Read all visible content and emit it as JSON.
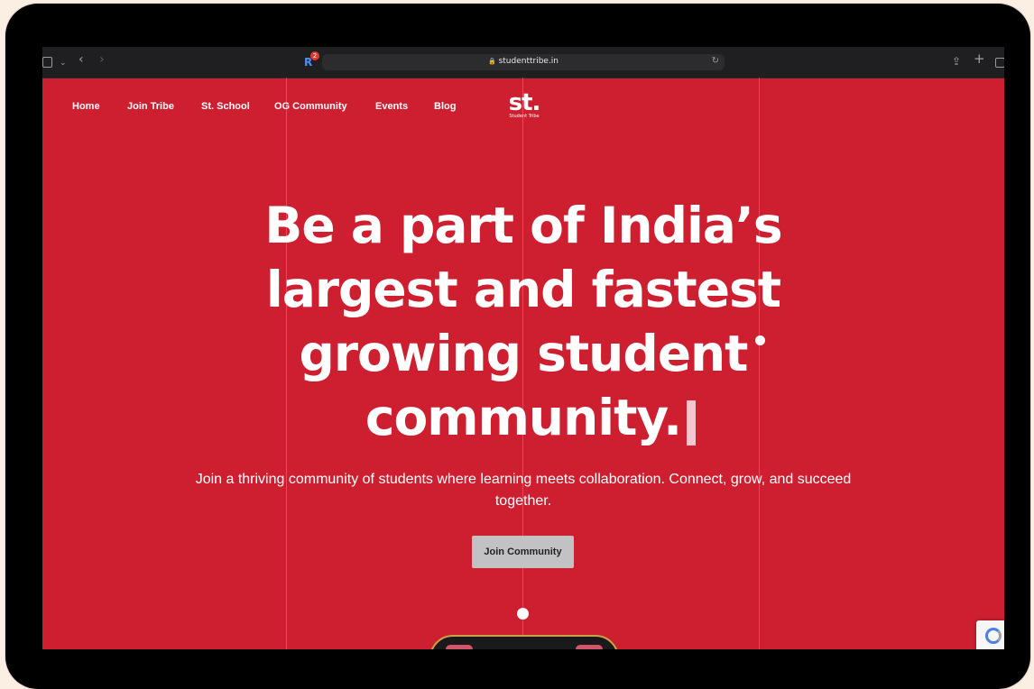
{
  "browser": {
    "url": "studenttribe.in",
    "lock_icon": "🔒",
    "extension_badge": "2",
    "extension_letter": "R"
  },
  "nav": {
    "items": [
      "Home",
      "Join Tribe",
      "St. School",
      "OG Community",
      "Events",
      "Blog"
    ]
  },
  "logo": {
    "mark": "st.",
    "subtitle": "Student Tribe"
  },
  "hero": {
    "headline_lines": [
      "Be a part of India’s",
      "largest and fastest",
      "growing student",
      "community."
    ],
    "subtext": "Join a thriving community of students where learning meets collaboration. Connect, grow, and succeed together.",
    "cta_label": "Join Community"
  },
  "colors": {
    "brand_red": "#cd1f30",
    "button_gray": "#c2c2c4"
  },
  "icons": [
    "sidebar-icon",
    "chevron-down-icon",
    "back-icon",
    "forward-icon",
    "lock-icon",
    "reload-icon",
    "share-icon",
    "plus-icon",
    "tabs-icon",
    "recaptcha-icon"
  ]
}
